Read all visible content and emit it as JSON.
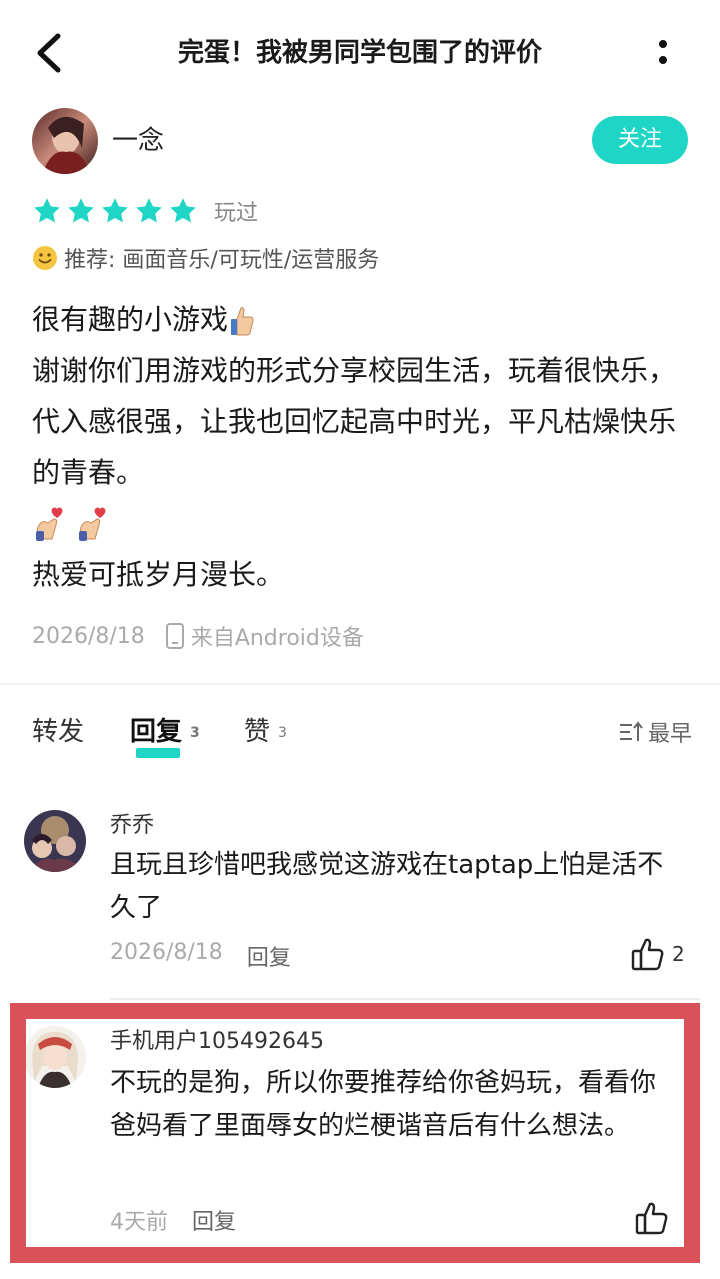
{
  "header": {
    "title": "完蛋！我被男同学包围了的评价"
  },
  "review": {
    "author": "一念",
    "follow_label": "关注",
    "rating": 5,
    "status": "玩过",
    "recommend": "推荐: 画面音乐/可玩性/运营服务",
    "lines": [
      "很有趣的小游戏",
      "谢谢你们用游戏的形式分享校园生活，玩着很快乐，代入感很强，让我也回忆起高中时光，平凡枯燥快乐的青春。",
      "热爱可抵岁月漫长。"
    ],
    "date": "2026/8/18",
    "device": "来自Android设备"
  },
  "tabs": {
    "forward": "转发",
    "reply": "回复",
    "reply_count": "3",
    "like": "赞",
    "like_count": "3",
    "sort": "最早"
  },
  "comments": [
    {
      "name": "乔乔",
      "text": "且玩且珍惜吧我感觉这游戏在taptap上怕是活不久了",
      "date": "2026/8/18",
      "reply_label": "回复",
      "likes": "2"
    },
    {
      "name": "手机用户105492645",
      "text": "不玩的是狗，所以你要推荐给你爸妈玩，看看你爸妈看了里面辱女的烂梗谐音后有什么想法。",
      "date": "4天前",
      "reply_label": "回复",
      "likes": ""
    }
  ],
  "colors": {
    "accent": "#1fd5c5",
    "highlight_border": "#d9525a"
  }
}
